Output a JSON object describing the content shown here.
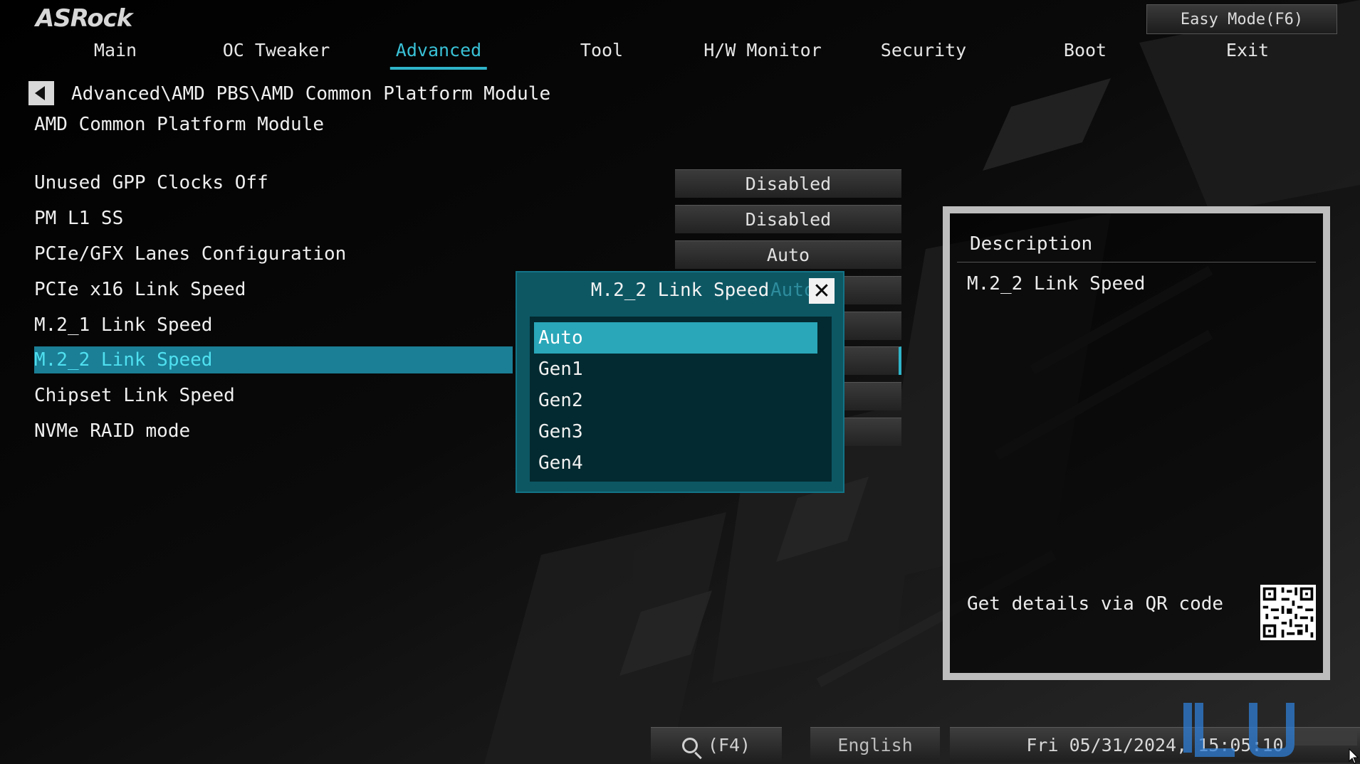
{
  "brand": {
    "logo_text": "ASRock"
  },
  "header": {
    "easy_mode_label": "Easy Mode(F6)",
    "tabs": [
      {
        "label": "Main"
      },
      {
        "label": "OC Tweaker"
      },
      {
        "label": "Advanced"
      },
      {
        "label": "Tool"
      },
      {
        "label": "H/W Monitor"
      },
      {
        "label": "Security"
      },
      {
        "label": "Boot"
      },
      {
        "label": "Exit"
      }
    ],
    "active_tab": "Advanced"
  },
  "nav": {
    "breadcrumb": "Advanced\\AMD PBS\\AMD Common Platform Module",
    "page_title": "AMD Common Platform Module"
  },
  "settings": [
    {
      "label": "Unused GPP Clocks Off",
      "value": "Disabled"
    },
    {
      "label": "PM L1 SS",
      "value": "Disabled"
    },
    {
      "label": "PCIe/GFX Lanes Configuration",
      "value": "Auto"
    },
    {
      "label": "PCIe x16 Link Speed",
      "value": ""
    },
    {
      "label": "M.2_1 Link Speed",
      "value": ""
    },
    {
      "label": "M.2_2 Link Speed",
      "value": ""
    },
    {
      "label": "Chipset Link Speed",
      "value": ""
    },
    {
      "label": "NVMe RAID mode",
      "value": ""
    }
  ],
  "popup": {
    "title": "M.2_2 Link Speed",
    "ghost_value": "Auto",
    "options": [
      {
        "label": "Auto"
      },
      {
        "label": "Gen1"
      },
      {
        "label": "Gen2"
      },
      {
        "label": "Gen3"
      },
      {
        "label": "Gen4"
      }
    ],
    "selected": "Auto"
  },
  "description": {
    "title": "Description",
    "text": "M.2_2 Link Speed",
    "qr_label": "Get details via QR code"
  },
  "footer": {
    "search_label": "(F4)",
    "language": "English",
    "datetime": "Fri 05/31/2024, 15:05:10"
  },
  "colors": {
    "accent": "#2fb4c9",
    "selection": "#1b7f96",
    "popup_bg": "#0d5763"
  },
  "icons": {
    "back": "back-arrow-icon",
    "close": "close-icon",
    "search": "search-icon",
    "qr": "qr-code-icon"
  }
}
